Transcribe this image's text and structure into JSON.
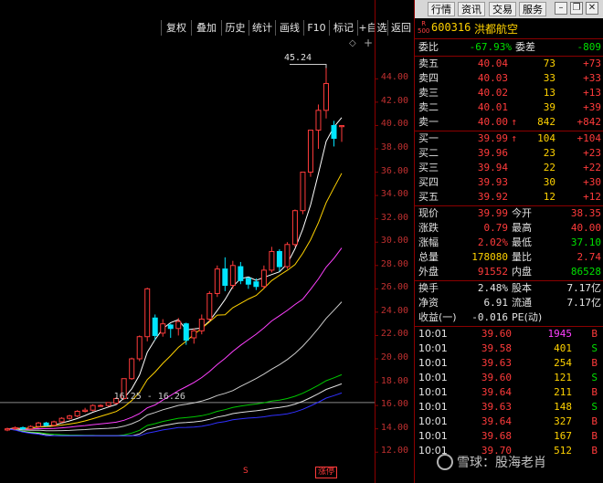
{
  "toolbar": {
    "items": [
      "复权",
      "叠加",
      "历史",
      "统计",
      "画线",
      "F10",
      "标记",
      "+自选",
      "返回"
    ]
  },
  "top_tabs": [
    "行情",
    "资讯",
    "交易",
    "服务"
  ],
  "stock": {
    "badge_top": "R",
    "badge_bottom": "500",
    "code": "600316",
    "name": "洪都航空"
  },
  "chart_data": {
    "type": "candlestick",
    "ylim": [
      11.0,
      47.0
    ],
    "y_ticks": [
      "44.00",
      "42.00",
      "40.00",
      "38.00",
      "36.00",
      "34.00",
      "32.00",
      "30.00",
      "28.00",
      "26.00",
      "24.00",
      "22.00",
      "20.00",
      "18.00",
      "16.00",
      "14.00",
      "12.00"
    ],
    "peak_label": "45.24",
    "ref_label": "16.25 - 16.26",
    "ref_price": 16.25,
    "limit_up_tag": "涨停",
    "s_marker": "S",
    "candles": [
      [
        13.9,
        14.0,
        13.8,
        14.1
      ],
      [
        14.0,
        14.1,
        13.9,
        14.2
      ],
      [
        14.1,
        14.0,
        13.9,
        14.2
      ],
      [
        14.0,
        14.2,
        13.9,
        14.3
      ],
      [
        14.2,
        14.5,
        14.1,
        14.6
      ],
      [
        14.5,
        14.3,
        14.2,
        14.6
      ],
      [
        14.3,
        14.6,
        14.2,
        14.7
      ],
      [
        14.6,
        14.9,
        14.5,
        15.0
      ],
      [
        14.9,
        15.1,
        14.8,
        15.2
      ],
      [
        15.1,
        15.5,
        15.0,
        15.6
      ],
      [
        15.5,
        15.6,
        15.4,
        15.8
      ],
      [
        15.6,
        16.0,
        15.5,
        16.1
      ],
      [
        16.0,
        16.0,
        15.9,
        16.1
      ],
      [
        16.0,
        16.25,
        15.9,
        16.26
      ],
      [
        16.2,
        16.6,
        16.1,
        16.7
      ],
      [
        16.6,
        18.3,
        16.5,
        18.3
      ],
      [
        18.3,
        20.0,
        18.2,
        20.1
      ],
      [
        20.0,
        21.9,
        19.8,
        22.0
      ],
      [
        21.9,
        26.0,
        21.5,
        26.1
      ],
      [
        23.5,
        22.0,
        21.6,
        23.8
      ],
      [
        22.2,
        23.0,
        21.9,
        23.4
      ],
      [
        22.9,
        22.6,
        21.8,
        23.0
      ],
      [
        22.6,
        23.2,
        22.0,
        23.5
      ],
      [
        23.0,
        21.6,
        21.2,
        23.1
      ],
      [
        21.8,
        22.4,
        21.3,
        22.6
      ],
      [
        22.4,
        23.4,
        22.1,
        23.8
      ],
      [
        23.4,
        25.6,
        23.2,
        25.8
      ],
      [
        25.6,
        27.7,
        25.3,
        28.0
      ],
      [
        27.7,
        26.3,
        25.8,
        28.7
      ],
      [
        26.3,
        28.0,
        26.0,
        28.4
      ],
      [
        27.9,
        26.7,
        26.4,
        28.3
      ],
      [
        26.9,
        26.4,
        26.0,
        27.0
      ],
      [
        26.6,
        26.2,
        25.9,
        26.9
      ],
      [
        26.2,
        27.6,
        26.0,
        28.0
      ],
      [
        27.6,
        29.2,
        27.4,
        29.6
      ],
      [
        29.2,
        27.9,
        27.5,
        29.4
      ],
      [
        27.9,
        29.8,
        27.7,
        30.0
      ],
      [
        29.8,
        32.7,
        29.6,
        32.8
      ],
      [
        32.7,
        36.0,
        32.4,
        36.0
      ],
      [
        36.0,
        39.6,
        35.6,
        39.6
      ],
      [
        39.6,
        41.3,
        38.0,
        41.8
      ],
      [
        41.3,
        43.6,
        40.6,
        45.24
      ],
      [
        40.0,
        38.9,
        38.2,
        40.4
      ],
      [
        39.9,
        39.99,
        38.6,
        40.0
      ]
    ],
    "ma_colors": [
      "#ffffff",
      "#ffd200",
      "#ff40ff",
      "#cccccc",
      "#00c800",
      "#dddddd",
      "#3030ff"
    ]
  },
  "quote": {
    "weibi": {
      "label": "委比",
      "value": "-67.93%",
      "label2": "委差",
      "value2": "-809"
    },
    "asks": [
      {
        "label": "卖五",
        "price": "40.04",
        "vol": "73",
        "chg": "+73"
      },
      {
        "label": "卖四",
        "price": "40.03",
        "vol": "33",
        "chg": "+33"
      },
      {
        "label": "卖三",
        "price": "40.02",
        "vol": "13",
        "chg": "+13"
      },
      {
        "label": "卖二",
        "price": "40.01",
        "vol": "39",
        "chg": "+39"
      },
      {
        "label": "卖一",
        "price": "40.00",
        "arrow": "↑",
        "vol": "842",
        "chg": "+842"
      }
    ],
    "bids": [
      {
        "label": "买一",
        "price": "39.99",
        "arrow": "↑",
        "vol": "104",
        "chg": "+104"
      },
      {
        "label": "买二",
        "price": "39.96",
        "vol": "23",
        "chg": "+23"
      },
      {
        "label": "买三",
        "price": "39.94",
        "vol": "22",
        "chg": "+22"
      },
      {
        "label": "买四",
        "price": "39.93",
        "vol": "30",
        "chg": "+30"
      },
      {
        "label": "买五",
        "price": "39.92",
        "vol": "12",
        "chg": "+12"
      }
    ],
    "stats": [
      {
        "l1": "现价",
        "v1": "39.99",
        "c1": "red",
        "l2": "今开",
        "v2": "38.35",
        "c2": "red"
      },
      {
        "l1": "涨跌",
        "v1": "0.79",
        "c1": "red",
        "l2": "最高",
        "v2": "40.00",
        "c2": "red"
      },
      {
        "l1": "涨幅",
        "v1": "2.02%",
        "c1": "red",
        "l2": "最低",
        "v2": "37.10",
        "c2": "green"
      },
      {
        "l1": "总量",
        "v1": "178080",
        "c1": "yellow",
        "l2": "量比",
        "v2": "2.74",
        "c2": "red"
      },
      {
        "l1": "外盘",
        "v1": "91552",
        "c1": "red",
        "l2": "内盘",
        "v2": "86528",
        "c2": "green"
      }
    ],
    "fin": [
      {
        "l1": "换手",
        "v1": "2.48%",
        "l2": "股本",
        "v2": "7.17亿"
      },
      {
        "l1": "净资",
        "v1": "6.91",
        "l2": "流通",
        "v2": "7.17亿"
      },
      {
        "l1": "收益(一)",
        "v1": "-0.016",
        "l2": "PE(动)",
        "v2": ""
      }
    ],
    "ticks": [
      {
        "time": "10:01",
        "price": "39.60",
        "vol": "1945",
        "side": "B",
        "vc": "magenta",
        "sc": "red"
      },
      {
        "time": "10:01",
        "price": "39.58",
        "vol": "401",
        "side": "S",
        "vc": "yellow",
        "sc": "green"
      },
      {
        "time": "10:01",
        "price": "39.63",
        "vol": "254",
        "side": "B",
        "vc": "yellow",
        "sc": "red"
      },
      {
        "time": "10:01",
        "price": "39.60",
        "vol": "121",
        "side": "S",
        "vc": "yellow",
        "sc": "green"
      },
      {
        "time": "10:01",
        "price": "39.64",
        "vol": "211",
        "side": "B",
        "vc": "yellow",
        "sc": "red"
      },
      {
        "time": "10:01",
        "price": "39.63",
        "vol": "148",
        "side": "S",
        "vc": "yellow",
        "sc": "green"
      },
      {
        "time": "10:01",
        "price": "39.64",
        "vol": "327",
        "side": "B",
        "vc": "yellow",
        "sc": "red"
      },
      {
        "time": "10:01",
        "price": "39.68",
        "vol": "167",
        "side": "B",
        "vc": "yellow",
        "sc": "red"
      },
      {
        "time": "10:01",
        "price": "39.70",
        "vol": "512",
        "side": "B",
        "vc": "yellow",
        "sc": "red"
      }
    ]
  },
  "watermark": "雪球：股海老肖"
}
